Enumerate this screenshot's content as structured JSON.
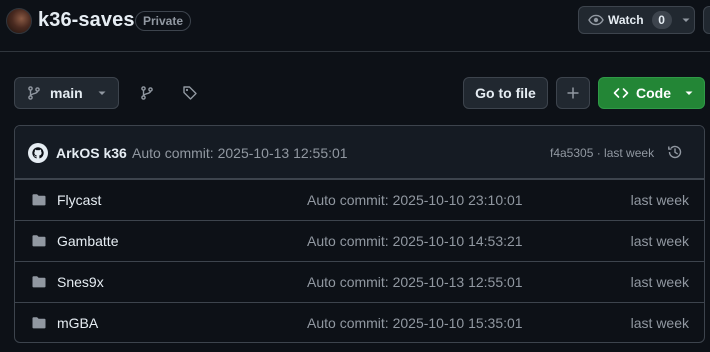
{
  "repo": {
    "name": "k36-saves",
    "visibility": "Private",
    "watch_label": "Watch",
    "watch_count": "0"
  },
  "toolbar": {
    "branch": "main",
    "go_to_file": "Go to file",
    "code_label": "Code"
  },
  "latest_commit": {
    "author": "ArkOS k36",
    "message": "Auto commit: 2025-10-13 12:55:01",
    "meta": "f4a5305 · last week"
  },
  "files": [
    {
      "name": "Flycast",
      "message": "Auto commit: 2025-10-10 23:10:01",
      "date": "last week"
    },
    {
      "name": "Gambatte",
      "message": "Auto commit: 2025-10-10 14:53:21",
      "date": "last week"
    },
    {
      "name": "Snes9x",
      "message": "Auto commit: 2025-10-13 12:55:01",
      "date": "last week"
    },
    {
      "name": "mGBA",
      "message": "Auto commit: 2025-10-10 15:35:01",
      "date": "last week"
    }
  ],
  "colors": {
    "background": "#0d1117",
    "border": "#3d444d",
    "text": "#e6edf3",
    "muted": "#9198a1",
    "code_button": "#238636",
    "folder": "#9198a1"
  },
  "icons": {
    "watch": "eye-icon",
    "branch": "git-branch-icon",
    "tags": "tag-icon",
    "add": "plus-icon",
    "code": "code-icon",
    "history": "history-icon",
    "folder": "folder-icon"
  }
}
